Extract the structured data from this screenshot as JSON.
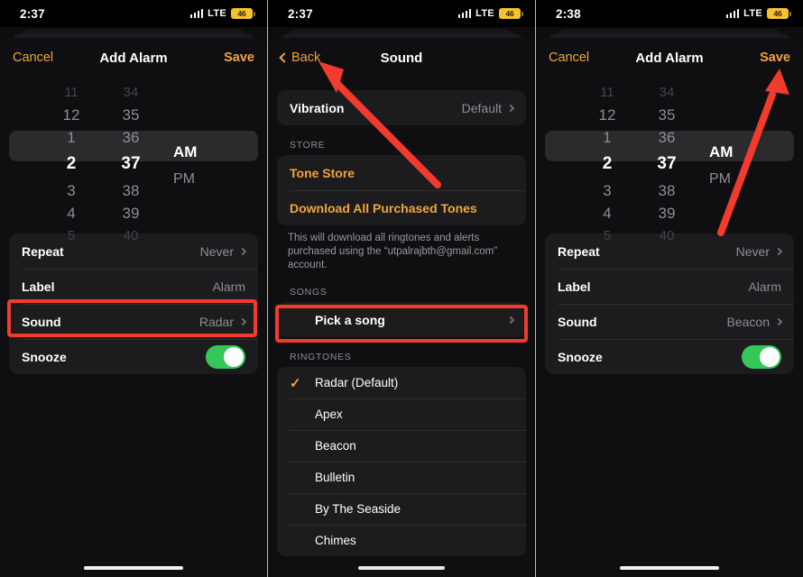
{
  "panels": [
    {
      "id": "add-alarm-before",
      "status": {
        "time": "2:37",
        "network": "LTE",
        "battery": "46"
      },
      "nav": {
        "left": "Cancel",
        "title": "Add Alarm",
        "right": "Save"
      },
      "picker": {
        "hours": [
          "11",
          "12",
          "1",
          "2",
          "3",
          "4",
          "5"
        ],
        "minutes": [
          "34",
          "35",
          "36",
          "37",
          "38",
          "39",
          "40"
        ],
        "meridiem": [
          "AM",
          "PM"
        ],
        "selected_hour": "2",
        "selected_minute": "37",
        "selected_meridiem": "AM"
      },
      "rows": [
        {
          "label": "Repeat",
          "value": "Never",
          "chevron": true
        },
        {
          "label": "Label",
          "value": "Alarm",
          "chevron": false
        },
        {
          "label": "Sound",
          "value": "Radar",
          "chevron": true
        },
        {
          "label": "Snooze",
          "toggle": "on"
        }
      ],
      "highlight_row": "Sound"
    },
    {
      "id": "sound-picker",
      "status": {
        "time": "2:37",
        "network": "LTE",
        "battery": "46"
      },
      "nav": {
        "left": "Back",
        "title": "Sound"
      },
      "vibration": {
        "label": "Vibration",
        "value": "Default"
      },
      "store": {
        "header": "STORE",
        "items": [
          "Tone Store",
          "Download All Purchased Tones"
        ],
        "footnote": "This will download all ringtones and alerts purchased using the “utpalrajbth@gmail.com” account."
      },
      "songs": {
        "header": "SONGS",
        "item": "Pick a song"
      },
      "ringtones": {
        "header": "RINGTONES",
        "items": [
          {
            "name": "Radar (Default)",
            "selected": true
          },
          {
            "name": "Apex",
            "selected": false
          },
          {
            "name": "Beacon",
            "selected": false
          },
          {
            "name": "Bulletin",
            "selected": false
          },
          {
            "name": "By The Seaside",
            "selected": false
          },
          {
            "name": "Chimes",
            "selected": false
          }
        ],
        "checkmark": "✓"
      }
    },
    {
      "id": "add-alarm-after",
      "status": {
        "time": "2:38",
        "network": "LTE",
        "battery": "46"
      },
      "nav": {
        "left": "Cancel",
        "title": "Add Alarm",
        "right": "Save"
      },
      "picker": {
        "hours": [
          "11",
          "12",
          "1",
          "2",
          "3",
          "4",
          "5"
        ],
        "minutes": [
          "34",
          "35",
          "36",
          "37",
          "38",
          "39",
          "40"
        ],
        "meridiem": [
          "AM",
          "PM"
        ],
        "selected_hour": "2",
        "selected_minute": "37",
        "selected_meridiem": "AM"
      },
      "rows": [
        {
          "label": "Repeat",
          "value": "Never",
          "chevron": true
        },
        {
          "label": "Label",
          "value": "Alarm",
          "chevron": false
        },
        {
          "label": "Sound",
          "value": "Beacon",
          "chevron": true
        },
        {
          "label": "Snooze",
          "toggle": "on"
        }
      ]
    }
  ],
  "colors": {
    "accent": "#f2a33c",
    "annotation_red": "#f23a2e",
    "toggle_on": "#34c759",
    "battery_low_power": "#f5c331",
    "panel_bg": "#0d0d0e",
    "group_bg": "#1c1c1e"
  },
  "annotations": {
    "arrow_back_label": "points-to-back-button",
    "arrow_save_label": "points-to-save-button",
    "highlight_sound_label": "sound-row-highlight",
    "highlight_pick_song_label": "pick-a-song-highlight"
  }
}
